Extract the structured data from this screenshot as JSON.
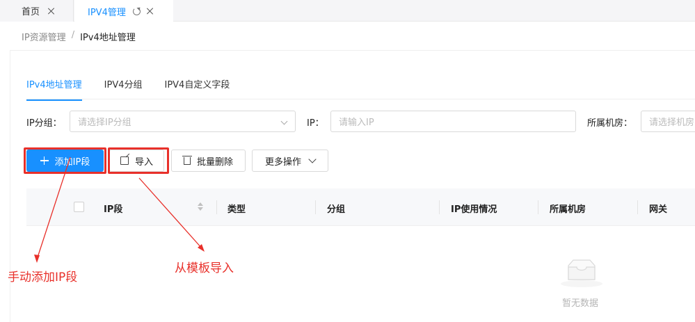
{
  "tabs": [
    {
      "label": "首页"
    },
    {
      "label": "IPV4管理"
    }
  ],
  "breadcrumb": {
    "parent": "IP资源管理",
    "separator": "/",
    "current": "IPv4地址管理"
  },
  "inner_tabs": [
    {
      "label": "IPv4地址管理",
      "active": true
    },
    {
      "label": "IPV4分组",
      "active": false
    },
    {
      "label": "IPV4自定义字段",
      "active": false
    }
  ],
  "filters": {
    "group": {
      "label": "IP分组：",
      "placeholder": "请选择IP分组"
    },
    "ip": {
      "label": "IP：",
      "placeholder": "请输入IP"
    },
    "room": {
      "label": "所属机房：",
      "placeholder": "请选择机房"
    }
  },
  "actions": {
    "add_label": "添加IP段",
    "import_label": "导入",
    "batch_delete_label": "批量删除",
    "more_label": "更多操作"
  },
  "table": {
    "columns": [
      "IP段",
      "类型",
      "分组",
      "IP使用情况",
      "所属机房",
      "网关"
    ],
    "empty_text": "暂无数据"
  },
  "annotations": {
    "add_note": "手动添加IP段",
    "import_note": "从模板导入",
    "color": "#e8302a"
  },
  "colors": {
    "primary": "#1890ff"
  }
}
